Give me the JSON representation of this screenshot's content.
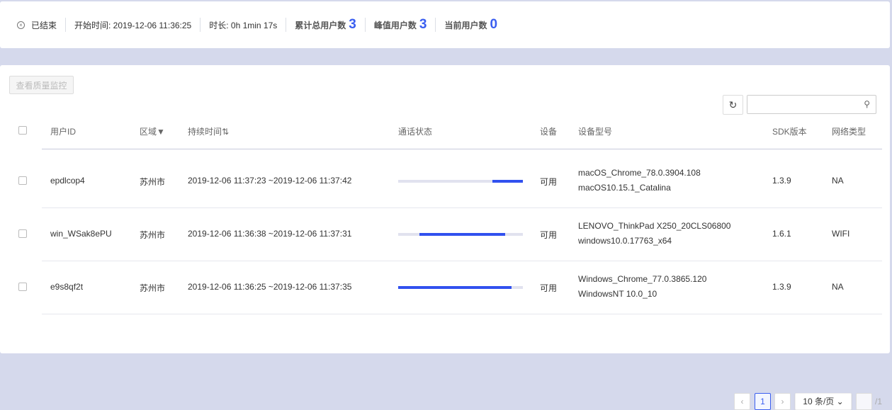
{
  "summary": {
    "status": "已结束",
    "start": "开始时间: 2019-12-06 11:36:25",
    "duration": "时长: 0h 1min 17s",
    "total_label": "累计总用户数",
    "total": "3",
    "peak_label": "峰值用户数",
    "peak": "3",
    "current_label": "当前用户数",
    "current": "0"
  },
  "toolbar": {
    "quality_button": "查看质量监控",
    "refresh_icon": "↻",
    "search_placeholder": "",
    "search_icon": "⚲"
  },
  "table": {
    "headers": {
      "user_id": "用户ID",
      "region": "区域▼",
      "duration": "持续时间⇅",
      "call_status": "通话状态",
      "device": "设备",
      "model": "设备型号",
      "sdk": "SDK版本",
      "network": "网络类型"
    },
    "rows": [
      {
        "user_id": "epdlcop4",
        "region": "苏州市",
        "time": "2019-12-06 11:37:23 ~2019-12-06 11:37:42",
        "call_start": 0.755,
        "call_end": 1.0,
        "device": "可用",
        "model1": "macOS_Chrome_78.0.3904.108",
        "model2": "macOS10.15.1_Catalina",
        "sdk": "1.3.9",
        "network": "NA"
      },
      {
        "user_id": "win_WSak8ePU",
        "region": "苏州市",
        "time": "2019-12-06 11:36:38 ~2019-12-06 11:37:31",
        "call_start": 0.17,
        "call_end": 0.86,
        "device": "可用",
        "model1": "LENOVO_ThinkPad X250_20CLS06800",
        "model2": "windows10.0.17763_x64",
        "sdk": "1.6.1",
        "network": "WIFI"
      },
      {
        "user_id": "e9s8qf2t",
        "region": "苏州市",
        "time": "2019-12-06 11:36:25 ~2019-12-06 11:37:35",
        "call_start": 0.0,
        "call_end": 0.91,
        "device": "可用",
        "model1": "Windows_Chrome_77.0.3865.120",
        "model2": "WindowsNT 10.0_10",
        "sdk": "1.3.9",
        "network": "NA"
      }
    ]
  },
  "pagination": {
    "prev": "‹",
    "page": "1",
    "next": "›",
    "page_size": "10 条/页",
    "total_pages": "/1"
  }
}
